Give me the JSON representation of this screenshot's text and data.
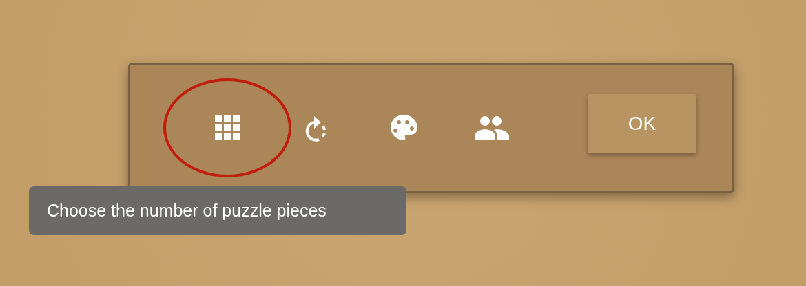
{
  "toolbar": {
    "tools": [
      {
        "kind": "grid",
        "highlighted": true
      },
      {
        "kind": "rotate",
        "highlighted": false
      },
      {
        "kind": "palette",
        "highlighted": false
      },
      {
        "kind": "people",
        "highlighted": false
      }
    ],
    "ok_button": "OK"
  },
  "tooltip": "Choose the number of puzzle pieces"
}
